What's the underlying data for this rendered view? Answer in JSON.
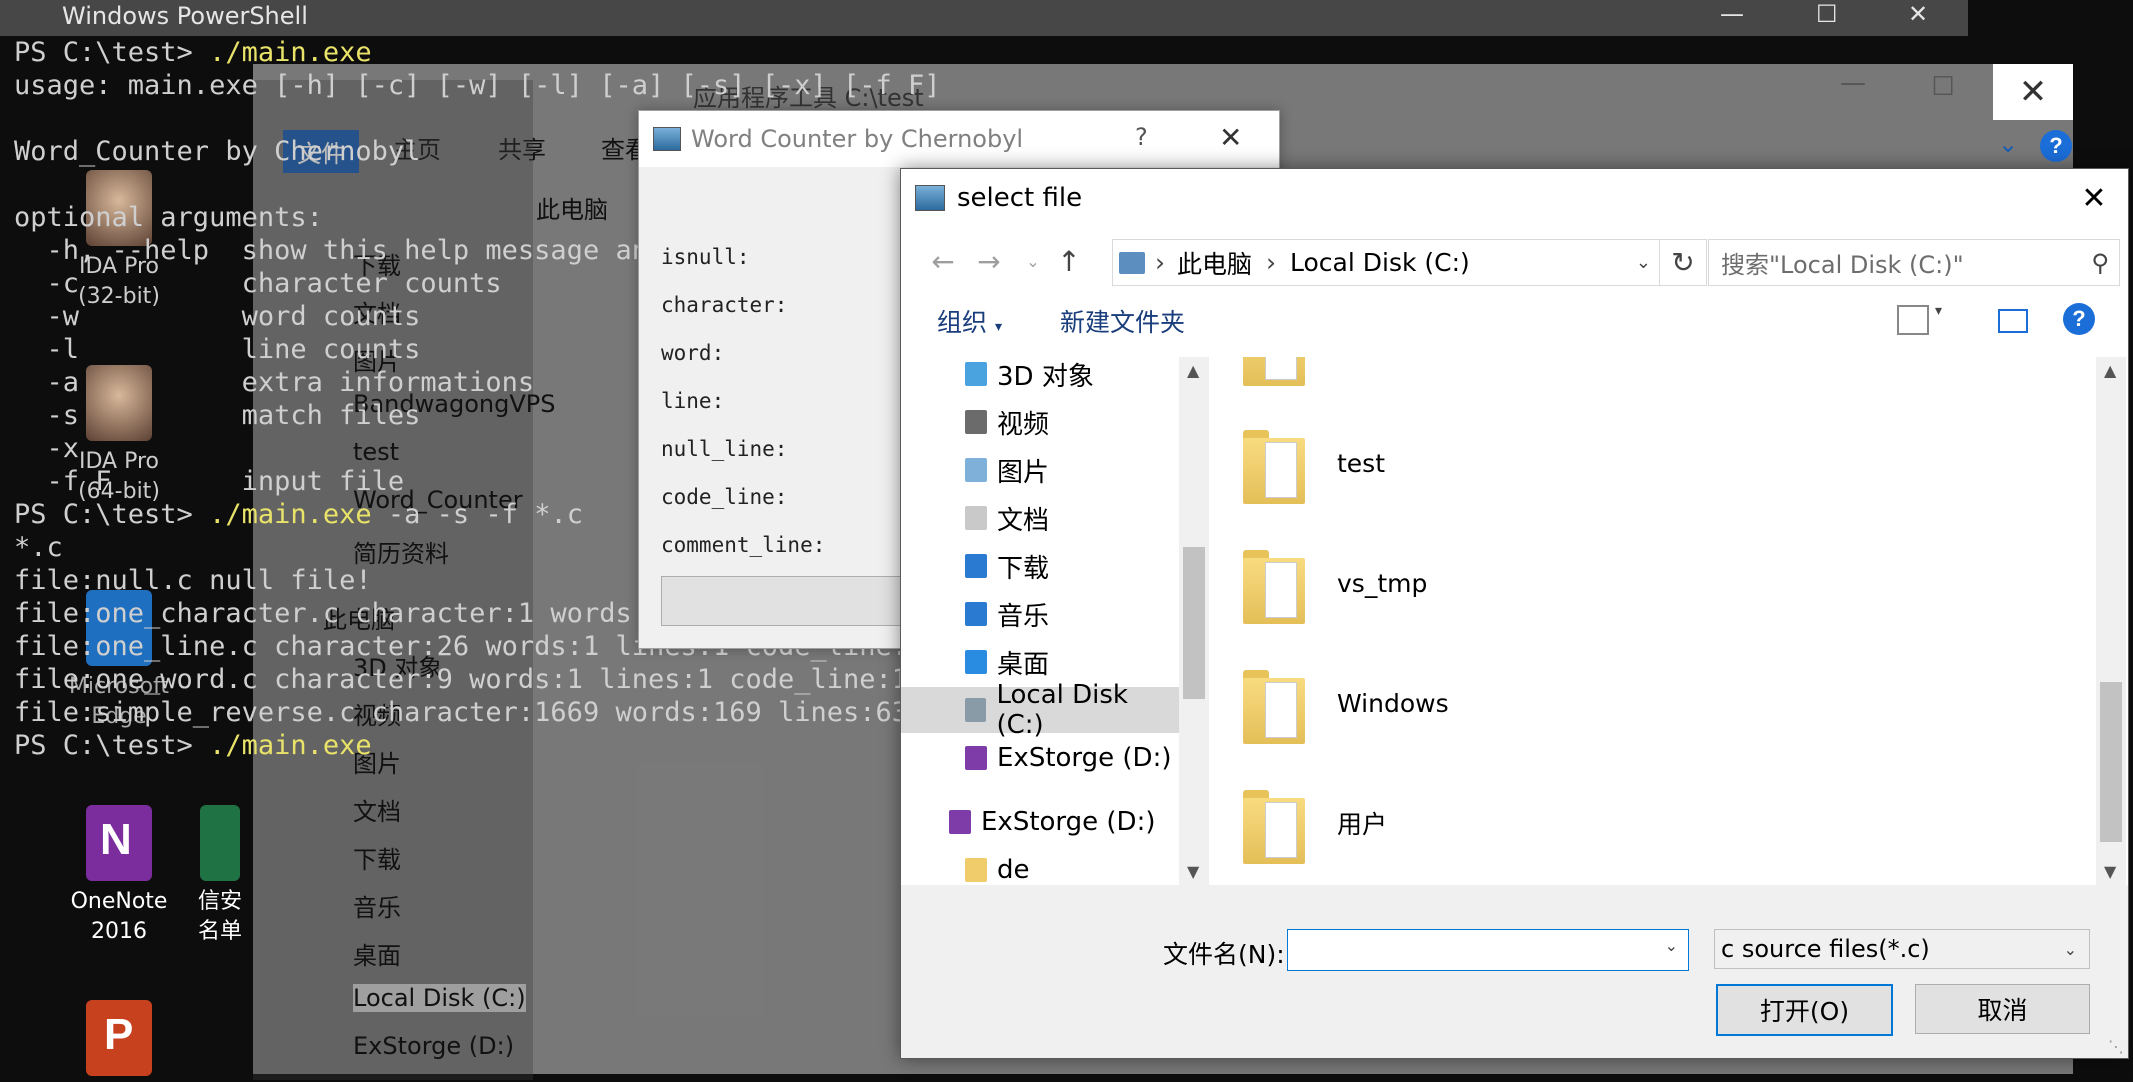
{
  "powershell": {
    "title": "Windows PowerShell",
    "lines": [
      "PS C:\\test> ",
      "usage: main.exe [-h] [-c] [-w] [-l] [-a] [-s] [-x] [-f F]",
      "",
      "Word_Counter by Chernobyl",
      "",
      "optional arguments:",
      "  -h, --help  show this help message and exit",
      "  -c          character counts",
      "  -w          word counts",
      "  -l          line counts",
      "  -a          extra informations",
      "  -s          match files",
      "  -x",
      "  -f F        input file",
      "PS C:\\test> ",
      "*.c",
      "file:null.c null file!",
      "file:one_character.c character:1 words:",
      "file:one_line.c character:26 words:1 lines:1 code_line:",
      "file:one_word.c character:9 words:1 lines:1 code_line:1",
      "file:simple_reverse.c character:1669 words:169 lines:63",
      "PS C:\\test> "
    ],
    "exe_cmd_1": "./main.exe",
    "exe_cmd_2": "./main.exe",
    "args_2": " -a -s -f *.c",
    "exe_cmd_3": "./main.exe"
  },
  "desktop": {
    "icons": [
      {
        "label": "IDA Pro (32-bit)",
        "icon": "ida-icon"
      },
      {
        "label": "IDA Pro (64-bit)",
        "icon": "ida-icon"
      },
      {
        "label": "Microsoft Edge",
        "icon": "edge-icon"
      },
      {
        "label": "OneNote 2016",
        "icon": "onenote-icon"
      },
      {
        "label": "信安 名单",
        "icon": "excel-icon"
      },
      {
        "label": "",
        "icon": "powerpoint-icon"
      }
    ]
  },
  "explorer": {
    "title": "应用程序工具  C:\\test",
    "tabs": [
      "文件",
      "主页",
      "共享",
      "查看"
    ],
    "breadcrumb": "此电脑",
    "nav_items": [
      "下载",
      "文档",
      "图片",
      "BandwagongVPS",
      "test",
      "Word_Counter",
      "简历资料",
      "此电脑",
      "3D 对象",
      "视频",
      "图片",
      "文档",
      "下载",
      "音乐",
      "桌面",
      "Local Disk (C:)",
      "ExStorge (D:)"
    ]
  },
  "word_counter": {
    "title": "Word Counter by Chernobyl",
    "help_glyph": "?",
    "labels": [
      "isnull:",
      "character:",
      "word:",
      "line:",
      "null_line:",
      "code_line:",
      "comment_line:"
    ]
  },
  "dialog": {
    "title": "select file",
    "address": [
      "此电脑",
      "Local Disk (C:)"
    ],
    "search_placeholder": "搜索\"Local Disk (C:)\"",
    "organize": "组织",
    "new_folder": "新建文件夹",
    "tree": [
      {
        "label": "3D 对象",
        "color": "#4aa3df"
      },
      {
        "label": "视频",
        "color": "#6b6b6b"
      },
      {
        "label": "图片",
        "color": "#7fb0d9"
      },
      {
        "label": "文档",
        "color": "#c9c9c9"
      },
      {
        "label": "下载",
        "color": "#2a7ad1"
      },
      {
        "label": "音乐",
        "color": "#2a7ad1"
      },
      {
        "label": "桌面",
        "color": "#2a8ce0"
      },
      {
        "label": "Local Disk (C:)",
        "color": "#8a9ba8",
        "selected": true
      },
      {
        "label": "ExStorge (D:)",
        "color": "#7d3ca8"
      }
    ],
    "tree_extra": [
      {
        "label": "ExStorge (D:)"
      },
      {
        "label": "de"
      }
    ],
    "folders": [
      "test",
      "vs_tmp",
      "Windows",
      "用户"
    ],
    "filename_label": "文件名(N):",
    "filename_value": "",
    "filter_value": "c source files(*.c)",
    "open_button": "打开(O)",
    "cancel_button": "取消"
  }
}
